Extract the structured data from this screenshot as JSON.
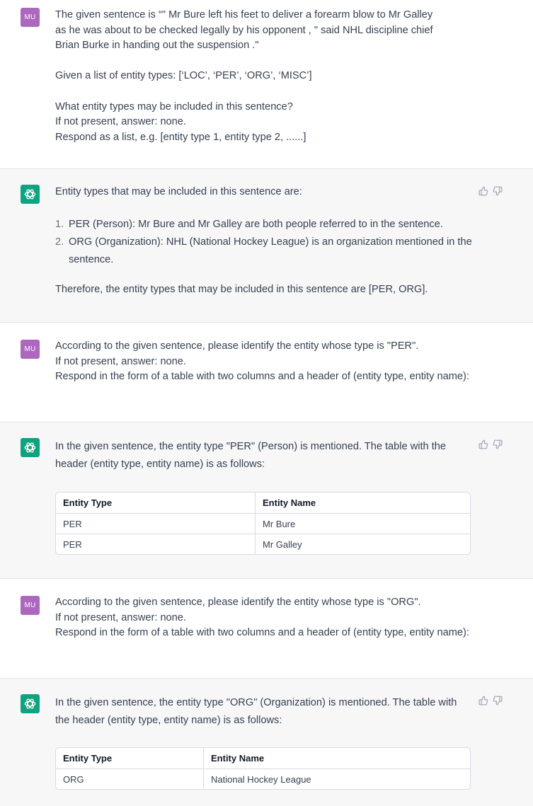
{
  "user_avatar_initials": "MU",
  "colors": {
    "user_avatar": "#ab68bd",
    "assistant_avatar": "#10a37f",
    "assistant_bg": "#f7f7f8"
  },
  "icons": {
    "assistant": "openai-logo-icon",
    "like": "thumbs-up-icon",
    "dislike": "thumbs-down-icon"
  },
  "messages": [
    {
      "role": "user",
      "lines": [
        "The given sentence is “\" Mr Bure left his feet to deliver a forearm blow to Mr Galley",
        "as he was about to be checked legally by his opponent , \" said NHL discipline chief",
        "Brian Burke in handing out the suspension .\"",
        "",
        "Given a list of entity types: [‘LOC’, ‘PER’, ‘ORG’, ‘MISC’]",
        "",
        "What entity types may be included in this sentence?",
        "If not present, answer: none.",
        "Respond as a list, e.g. [entity type 1, entity type 2, ......]"
      ]
    },
    {
      "role": "assistant",
      "intro": "Entity types that may be included in this sentence are:",
      "list": [
        {
          "num": "1.",
          "text": "PER (Person): Mr Bure and Mr Galley are both people referred to in the sentence."
        },
        {
          "num": "2.",
          "text": "ORG (Organization): NHL (National Hockey League) is an organization mentioned in the sentence."
        }
      ],
      "conclusion": "Therefore, the entity types that may be included in this sentence are [PER, ORG]."
    },
    {
      "role": "user",
      "lines": [
        "According to the given sentence, please identify the entity whose type is \"PER\".",
        "If not present, answer: none.",
        "Respond in the form of a table with two columns and a header of (entity type, entity name):"
      ]
    },
    {
      "role": "assistant",
      "intro": "In the given sentence, the entity type \"PER\" (Person) is mentioned. The table with the header (entity type, entity name) is as follows:",
      "table": {
        "headers": [
          "Entity Type",
          "Entity Name"
        ],
        "rows": [
          [
            "PER",
            "Mr Bure"
          ],
          [
            "PER",
            "Mr Galley"
          ]
        ]
      }
    },
    {
      "role": "user",
      "lines": [
        "According to the given sentence, please identify the entity whose type is \"ORG\".",
        "If not present, answer: none.",
        "Respond in the form of a table with two columns and a header of (entity type, entity name):"
      ]
    },
    {
      "role": "assistant",
      "intro": "In the given sentence, the entity type \"ORG\" (Organization) is mentioned. The table with the header (entity type, entity name) is as follows:",
      "table": {
        "headers": [
          "Entity Type",
          "Entity Name"
        ],
        "rows": [
          [
            "ORG",
            "National Hockey League"
          ]
        ]
      }
    }
  ]
}
